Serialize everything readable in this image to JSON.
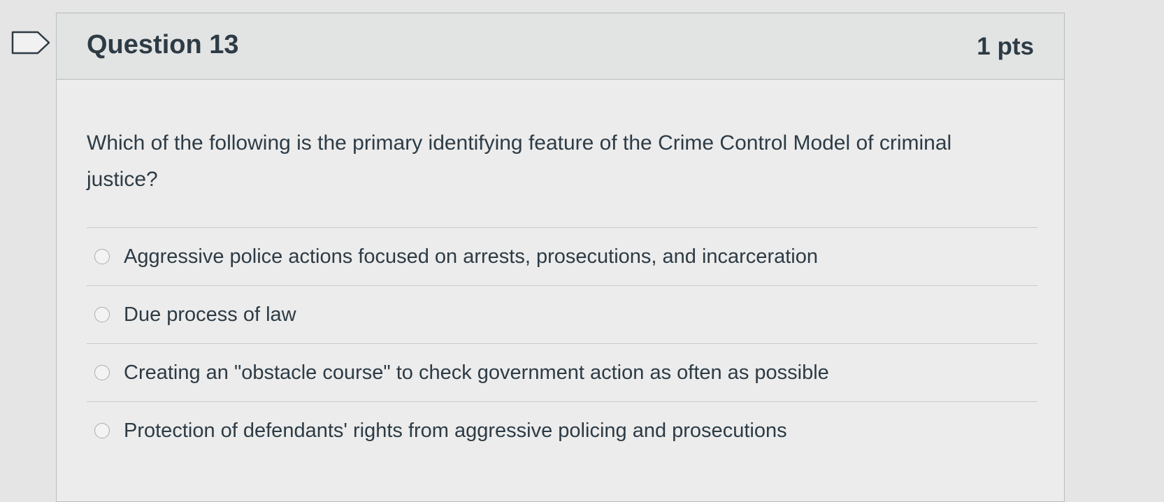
{
  "question": {
    "title": "Question 13",
    "points": "1 pts",
    "text": "Which of the following is the primary identifying feature of the Crime Control Model of criminal justice?"
  },
  "answers": [
    {
      "label": "Aggressive police actions focused on arrests, prosecutions, and incarceration"
    },
    {
      "label": "Due process of law"
    },
    {
      "label": "Creating an \"obstacle course\" to check government action as often as possible"
    },
    {
      "label": "Protection of defendants' rights from aggressive policing and prosecutions"
    }
  ],
  "icons": {
    "flag": "flag-icon"
  },
  "colors": {
    "text": "#2d3b45",
    "header_bg": "#e2e3e3",
    "border": "#b9bdbf"
  }
}
